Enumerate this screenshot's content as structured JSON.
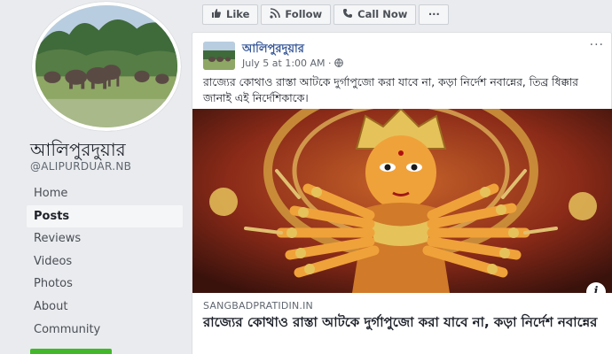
{
  "page": {
    "name": "আলিপুরদুয়ার",
    "handle": "@ALIPURDUAR.NB"
  },
  "nav": {
    "items": [
      {
        "label": "Home"
      },
      {
        "label": "Posts"
      },
      {
        "label": "Reviews"
      },
      {
        "label": "Videos"
      },
      {
        "label": "Photos"
      },
      {
        "label": "About"
      },
      {
        "label": "Community"
      }
    ],
    "active": "Posts"
  },
  "actions": {
    "like_label": "Like",
    "follow_label": "Follow",
    "call_label": "Call Now",
    "more_label": "···"
  },
  "post": {
    "author": "আলিপুরদুয়ার",
    "date": "July 5 at 1:00 AM",
    "privacy_icon": "globe-icon",
    "text": "রাজ্যের কোথাও রাস্তা আটকে দুর্গাপুজো করা যাবে না, কড়া নির্দেশ নবান্নের, তিব্র ধিক্কার জানাই এই নির্দেশিকাকে।",
    "options_label": "···",
    "link": {
      "domain": "SANGBADPRATIDIN.IN",
      "title": "রাজ্যের কোথাও রাস্তা আটকে দুর্গাপুজো করা যাবে না, কড়া নির্দেশ নবান্নের"
    },
    "info_label": "i"
  },
  "colors": {
    "background": "#e9ebee",
    "link_blue": "#385898",
    "card": "#ffffff",
    "green": "#42b72a"
  }
}
